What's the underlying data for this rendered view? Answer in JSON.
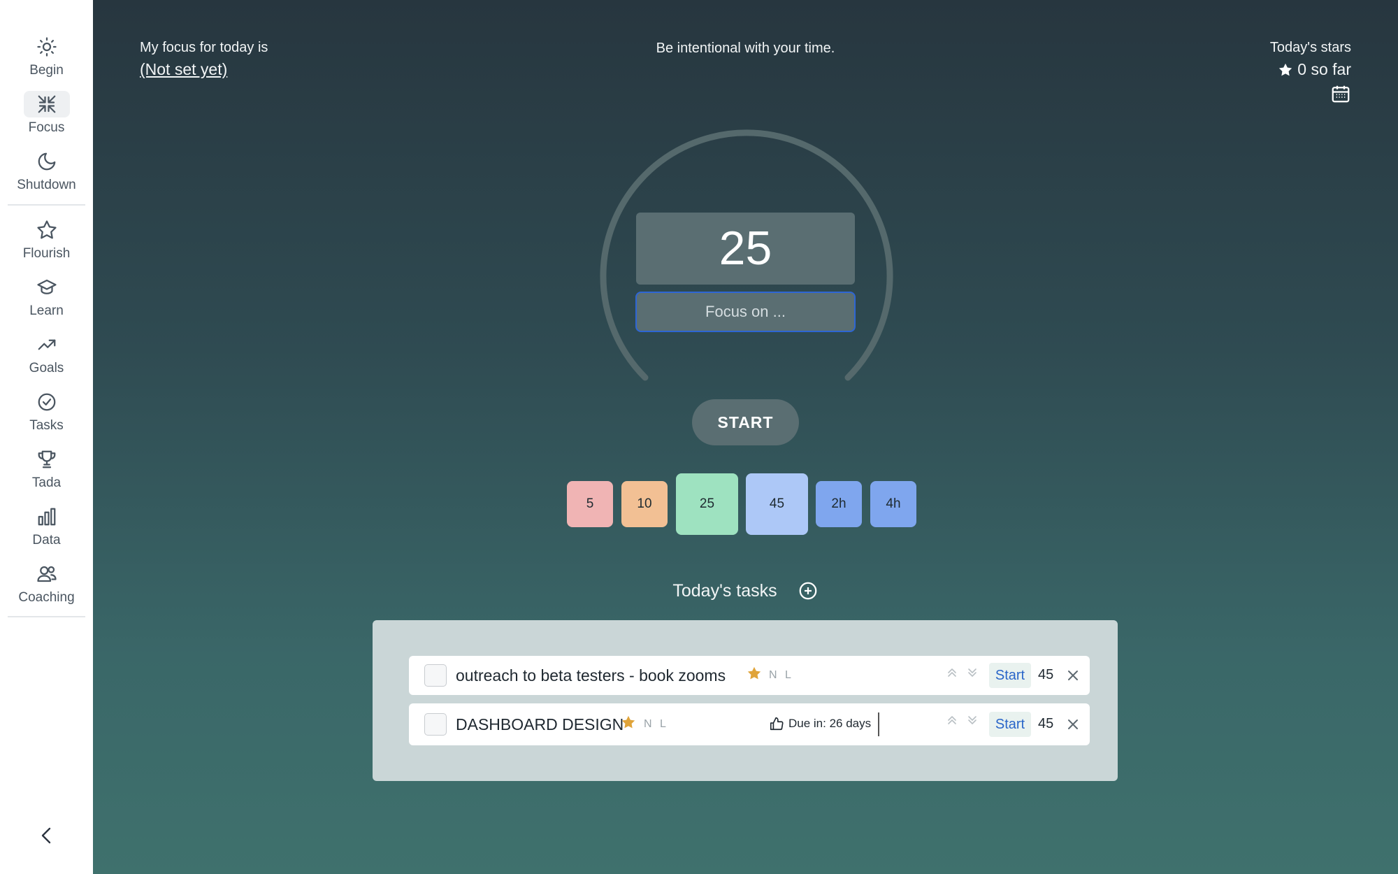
{
  "sidebar": {
    "items": [
      {
        "label": "Begin",
        "icon": "sun-icon"
      },
      {
        "label": "Focus",
        "icon": "minimize-icon",
        "active": true
      },
      {
        "label": "Shutdown",
        "icon": "moon-icon"
      },
      {
        "label": "Flourish",
        "icon": "star-icon"
      },
      {
        "label": "Learn",
        "icon": "graduation-cap-icon"
      },
      {
        "label": "Goals",
        "icon": "trending-up-icon"
      },
      {
        "label": "Tasks",
        "icon": "check-circle-icon"
      },
      {
        "label": "Tada",
        "icon": "trophy-icon"
      },
      {
        "label": "Data",
        "icon": "bar-chart-icon"
      },
      {
        "label": "Coaching",
        "icon": "users-icon"
      }
    ]
  },
  "header": {
    "focus_label": "My focus for today is",
    "focus_value": "(Not set yet)",
    "tagline": "Be intentional with your time.",
    "stars_label": "Today's stars",
    "stars_count": "0 so far"
  },
  "timer": {
    "minutes": "25",
    "focus_placeholder": "Focus on ...",
    "start_label": "START"
  },
  "presets": [
    {
      "label": "5",
      "color": "#f0b4b4"
    },
    {
      "label": "10",
      "color": "#f2c094"
    },
    {
      "label": "25",
      "color": "#9ee2c0"
    },
    {
      "label": "45",
      "color": "#adc8f7"
    },
    {
      "label": "2h",
      "color": "#7fa6ee"
    },
    {
      "label": "4h",
      "color": "#7fa6ee"
    }
  ],
  "tasks": {
    "title": "Today's tasks",
    "items": [
      {
        "text": "outreach to beta testers - book zooms",
        "tag_n": "N",
        "tag_l": "L",
        "start": "Start",
        "minutes": "45"
      },
      {
        "text": "DASHBOARD DESIGN",
        "tag_n": "N",
        "tag_l": "L",
        "due": "Due in: 26 days",
        "start": "Start",
        "minutes": "45"
      }
    ]
  },
  "colors": {
    "accent_blue": "#2e66d4",
    "star_gold": "#e0a43a"
  }
}
